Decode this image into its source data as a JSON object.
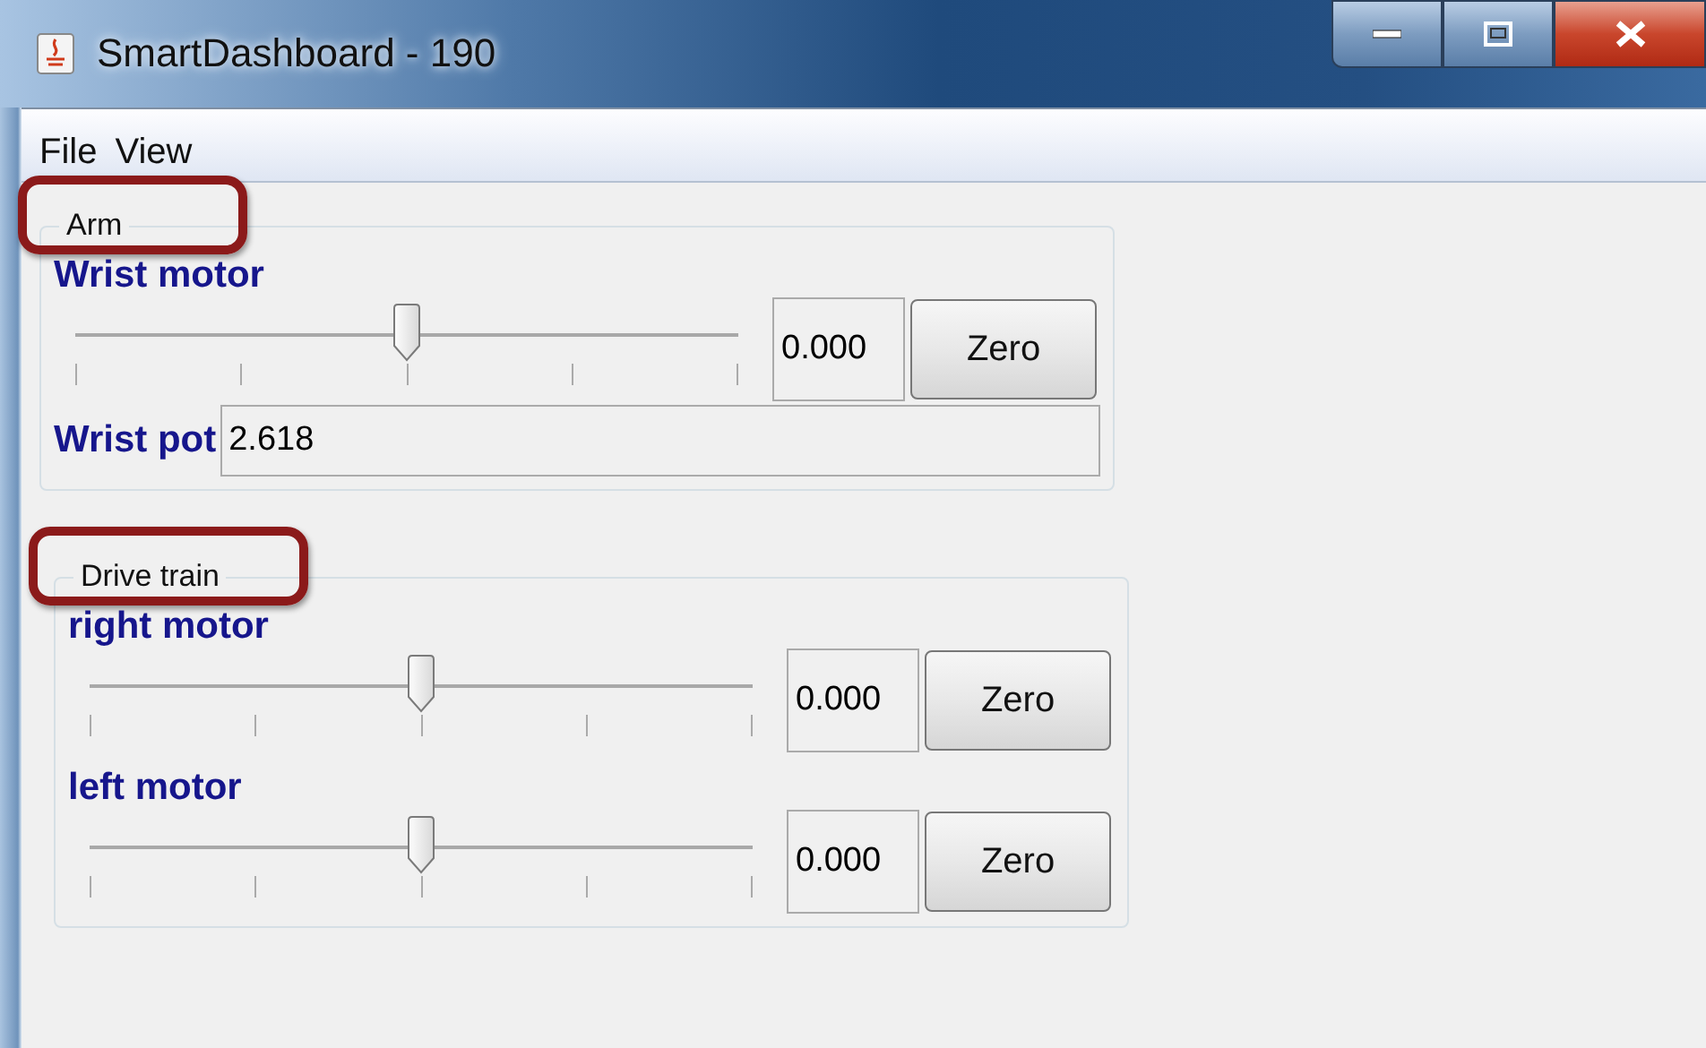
{
  "window": {
    "title": "SmartDashboard - 190"
  },
  "menu": [
    "File",
    "View"
  ],
  "groups": [
    {
      "title": "Arm",
      "highlighted": true,
      "rows": [
        {
          "kind": "slider",
          "label": "Wrist motor",
          "level": 0.5,
          "value": "0.000",
          "button": "Zero"
        },
        {
          "kind": "field",
          "label": "Wrist pot",
          "value": "2.618"
        }
      ]
    },
    {
      "title": "Drive train",
      "highlighted": true,
      "rows": [
        {
          "kind": "slider",
          "label": "right motor",
          "level": 0.5,
          "value": "0.000",
          "button": "Zero"
        },
        {
          "kind": "slider",
          "label": "left motor",
          "level": 0.5,
          "value": "0.000",
          "button": "Zero"
        }
      ]
    }
  ]
}
